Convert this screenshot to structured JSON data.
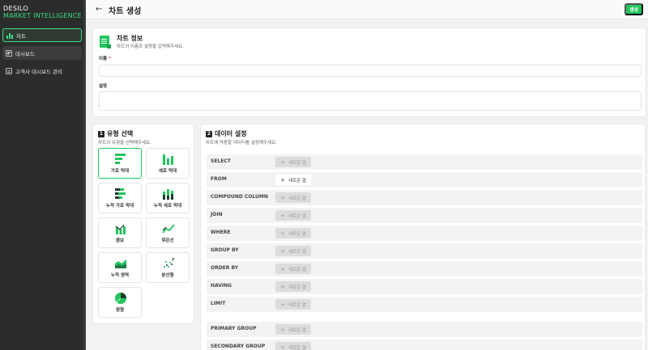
{
  "brand": {
    "line1": "DESILO",
    "line2": "MARKET INTELLIGENCE"
  },
  "sidebar": {
    "items": [
      {
        "label": "차트",
        "icon": "bar-chart-icon",
        "active": true
      },
      {
        "label": "대시보드",
        "icon": "dashboard-icon",
        "active": false
      },
      {
        "label": "고객사 대시보드 관리",
        "icon": "document-icon",
        "active": false
      }
    ]
  },
  "header": {
    "title": "차트 생성",
    "back_icon": "arrow-left-icon",
    "create_label": "생성"
  },
  "info": {
    "title": "차트 정보",
    "subtitle": "차트의 이름과 설명을 입력해주세요.",
    "name_label": "이름",
    "required_mark": "*",
    "name_value": "",
    "desc_label": "설명",
    "desc_value": ""
  },
  "type_section": {
    "number": "1",
    "title": "유형 선택",
    "subtitle": "차트의 유형을 선택해주세요.",
    "types": [
      {
        "label": "가로 막대",
        "icon": "horizontal-bar-icon",
        "selected": true
      },
      {
        "label": "세로 막대",
        "icon": "vertical-bar-icon",
        "selected": false
      },
      {
        "label": "누적 가로 막대",
        "icon": "stacked-horizontal-bar-icon",
        "selected": false
      },
      {
        "label": "누적 세로 막대",
        "icon": "stacked-vertical-bar-icon",
        "selected": false
      },
      {
        "label": "콤보",
        "icon": "combo-icon",
        "selected": false
      },
      {
        "label": "꺾은선",
        "icon": "line-icon",
        "selected": false
      },
      {
        "label": "누적 영역",
        "icon": "stacked-area-icon",
        "selected": false
      },
      {
        "label": "분산형",
        "icon": "scatter-icon",
        "selected": false
      },
      {
        "label": "원형",
        "icon": "pie-icon",
        "selected": false
      }
    ]
  },
  "data_section": {
    "number": "2",
    "title": "데이터 설정",
    "subtitle": "차트에 적용할 데이터를 설정해주세요.",
    "add_label": "새로운 열",
    "clauses": [
      {
        "label": "SELECT",
        "enabled": false
      },
      {
        "label": "FROM",
        "enabled": true
      },
      {
        "label": "COMPOUND COLUMN",
        "enabled": false
      },
      {
        "label": "JOIN",
        "enabled": false
      },
      {
        "label": "WHERE",
        "enabled": false
      },
      {
        "label": "GROUP BY",
        "enabled": false
      },
      {
        "label": "ORDER BY",
        "enabled": false
      },
      {
        "label": "HAVING",
        "enabled": false
      },
      {
        "label": "LIMIT",
        "enabled": false
      }
    ],
    "groups": [
      {
        "label": "PRIMARY GROUP",
        "enabled": false
      },
      {
        "label": "SECONDARY GROUP",
        "enabled": false
      }
    ]
  },
  "colors": {
    "accent": "#22c55e",
    "sidebar_bg": "#2b2d2c",
    "brand_green": "#3ddc84"
  }
}
